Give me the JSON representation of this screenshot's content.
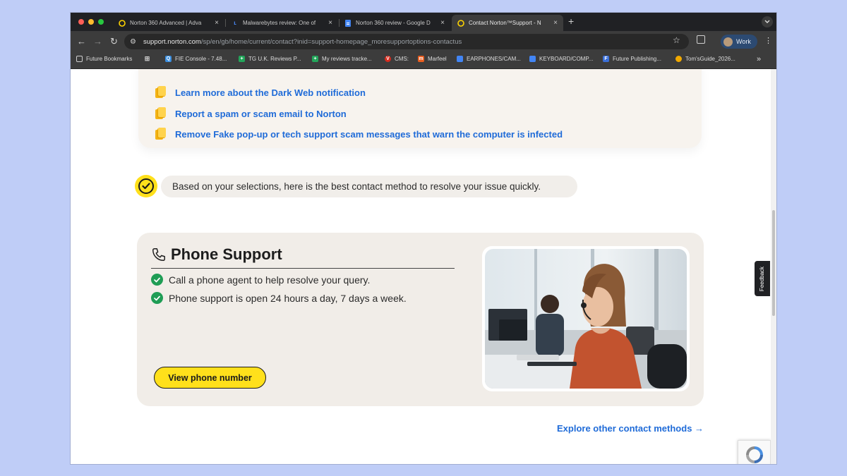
{
  "browser": {
    "tabs": [
      {
        "title": "Norton 360 Advanced | Adva",
        "icon": "norton-icon",
        "active": false
      },
      {
        "title": "Malwarebytes review: One of",
        "icon": "malwarebytes-icon",
        "active": false
      },
      {
        "title": "Norton 360 review - Google D",
        "icon": "google-docs-icon",
        "active": false
      },
      {
        "title": "Contact Norton™Support - N",
        "icon": "norton-icon",
        "active": true
      }
    ],
    "new_tab_label": "+",
    "url_host": "support.norton.com",
    "url_path": "/sp/en/gb/home/current/contact?inid=support-homepage_moresupportoptions-contactus",
    "profile_name": "Work",
    "bookmarks": [
      {
        "label": "Future Bookmarks",
        "icon": "folder-icon"
      },
      {
        "label": "",
        "icon": "apps-grid-icon"
      },
      {
        "label": "FIE Console - 7.48...",
        "icon": "fie-icon"
      },
      {
        "label": "TG U.K. Reviews P...",
        "icon": "sheets-icon"
      },
      {
        "label": "My reviews tracke...",
        "icon": "sheets-icon"
      },
      {
        "label": "CMS:",
        "icon": "vanilla-icon"
      },
      {
        "label": "Marfeel",
        "icon": "marfeel-icon"
      },
      {
        "label": "EARPHONES/CAM...",
        "icon": "docs-icon"
      },
      {
        "label": "KEYBOARD/COMP...",
        "icon": "docs-icon"
      },
      {
        "label": "Future Publishing...",
        "icon": "future-icon"
      },
      {
        "label": "Tom'sGuide_2026...",
        "icon": "tomsguide-icon"
      }
    ],
    "bookmarks_more": "»"
  },
  "help_links": [
    "Learn more about the Dark Web notification",
    "Report a spam or scam email to Norton",
    "Remove Fake pop-up or tech support scam messages that warn the computer is infected"
  ],
  "recommendation": "Based on your selections, here is the best contact method to resolve your issue quickly.",
  "phone_support": {
    "title": "Phone Support",
    "features": [
      "Call a phone agent to help resolve your query.",
      "Phone support is open 24 hours a day, 7 days a week."
    ],
    "button": "View phone number"
  },
  "explore_link": "Explore other contact methods →",
  "feedback_tab": "Feedback",
  "colors": {
    "accent_yellow": "#ffe01b",
    "link_blue": "#1f6bd8",
    "check_green": "#1f9d55",
    "card_bg": "#f1ede8"
  }
}
